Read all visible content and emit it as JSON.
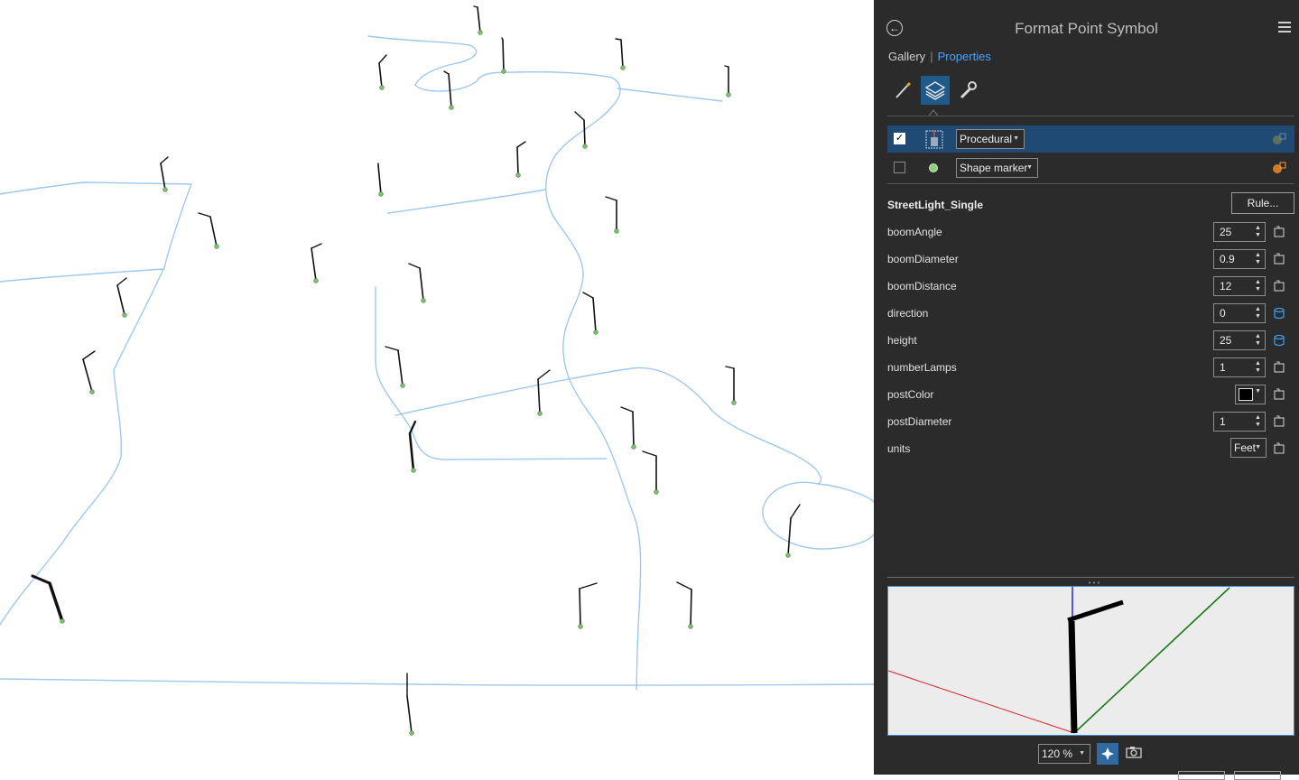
{
  "panel": {
    "title": "Format Point Symbol",
    "tabs": {
      "gallery": "Gallery",
      "properties": "Properties"
    },
    "icons": [
      "brush-icon",
      "layers-icon",
      "wrench-icon"
    ]
  },
  "symbol_layers": [
    {
      "checked": true,
      "type": "Procedural",
      "icon": "procedural-icon"
    },
    {
      "checked": false,
      "type": "Shape marker",
      "icon": "green-dot-icon"
    }
  ],
  "properties": {
    "rule_name": "StreetLight_Single",
    "rule_button": "Rule...",
    "fields": [
      {
        "label": "boomAngle",
        "value": "25",
        "kind": "number",
        "connection": "attribute-map"
      },
      {
        "label": "boomDiameter",
        "value": "0.9",
        "kind": "number",
        "connection": "attribute-map"
      },
      {
        "label": "boomDistance",
        "value": "12",
        "kind": "number",
        "connection": "attribute-map"
      },
      {
        "label": "direction",
        "value": "0",
        "kind": "number",
        "connection": "field-db"
      },
      {
        "label": "height",
        "value": "25",
        "kind": "number",
        "connection": "field-db"
      },
      {
        "label": "numberLamps",
        "value": "1",
        "kind": "number",
        "connection": "attribute-map"
      },
      {
        "label": "postColor",
        "value": "#000000",
        "kind": "color",
        "connection": "attribute-map"
      },
      {
        "label": "postDiameter",
        "value": "1",
        "kind": "number",
        "connection": "attribute-map"
      },
      {
        "label": "units",
        "value": "Feet",
        "kind": "dropdown",
        "connection": "attribute-map"
      }
    ]
  },
  "preview": {
    "zoom": "120 %"
  },
  "colors": {
    "panel_bg": "#2b2b2b",
    "accent": "#4aa3ff",
    "selected_row": "#1e4a73",
    "road": "#9ec8ee",
    "marker": "#7dbf6e"
  }
}
